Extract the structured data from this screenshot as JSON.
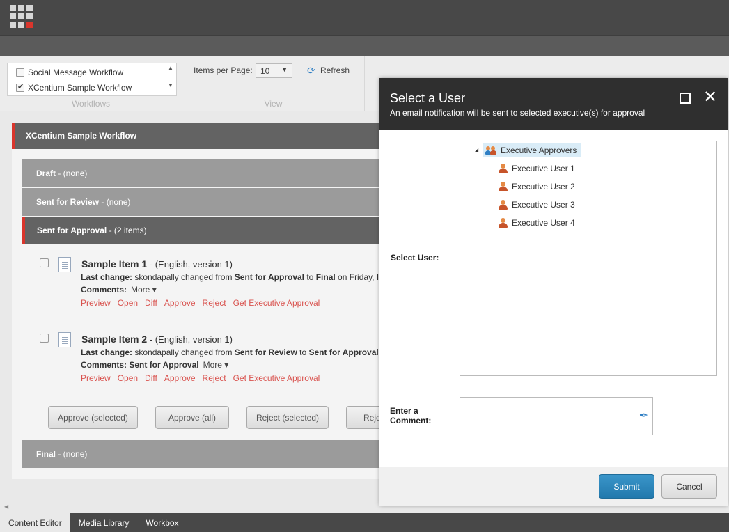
{
  "ribbon": {
    "workflows": [
      {
        "label": "Social Message Workflow",
        "checked": false
      },
      {
        "label": "XCentium Sample Workflow",
        "checked": true
      }
    ],
    "workflows_caption": "Workflows",
    "items_per_page_label": "Items per Page:",
    "items_per_page_value": "10",
    "refresh_label": "Refresh",
    "view_caption": "View"
  },
  "workflow": {
    "title": "XCentium Sample Workflow",
    "states": [
      {
        "name": "Draft",
        "suffix": " - (none)"
      },
      {
        "name": "Sent for Review",
        "suffix": " - (none)"
      },
      {
        "name": "Sent for Approval",
        "suffix": " - (2 items)"
      },
      {
        "name": "Final",
        "suffix": " - (none)"
      }
    ],
    "items": [
      {
        "title": "Sample Item 1",
        "meta": " - (English, version 1)",
        "last_change_label": "Last change:",
        "last_change_a": " skondapally changed from ",
        "last_change_from": "Sent for Approval",
        "last_change_b": " to ",
        "last_change_to": "Final",
        "last_change_c": " on Friday, I",
        "comments_label": "Comments:",
        "comments_value": "",
        "more_label": "More ▾"
      },
      {
        "title": "Sample Item 2",
        "meta": " - (English, version 1)",
        "last_change_label": "Last change:",
        "last_change_a": " skondapally changed from ",
        "last_change_from": "Sent for Review",
        "last_change_b": " to ",
        "last_change_to": "Sent for Approval",
        "last_change_c": "",
        "comments_label": "Comments:",
        "comments_value": " Sent for Approval",
        "more_label": "More ▾"
      }
    ],
    "actions": [
      "Preview",
      "Open",
      "Diff",
      "Approve",
      "Reject",
      "Get Executive Approval"
    ],
    "buttons": [
      "Approve (selected)",
      "Approve (all)",
      "Reject (selected)",
      "Reje"
    ]
  },
  "bottom_tabs": [
    "Content Editor",
    "Media Library",
    "Workbox"
  ],
  "dialog": {
    "title": "Select a User",
    "subtitle": "An email notification will be sent to selected executive(s) for approval",
    "select_user_label": "Select User:",
    "tree_root": "Executive Approvers",
    "users": [
      "Executive User 1",
      "Executive User 2",
      "Executive User 3",
      "Executive User 4"
    ],
    "comment_label_1": "Enter a",
    "comment_label_2": "Comment:",
    "submit_label": "Submit",
    "cancel_label": "Cancel"
  },
  "colors": {
    "accent_red": "#d9352c",
    "link_red": "#d9534f",
    "submit_blue": "#2279ad"
  }
}
